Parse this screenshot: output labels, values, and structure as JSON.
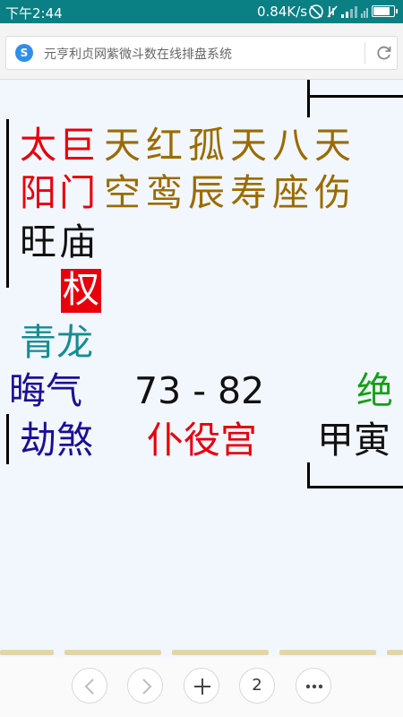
{
  "status_bar": {
    "time": "下午2:44",
    "network_speed": "0.84K/s",
    "battery_level": 0.85
  },
  "browser": {
    "page_title": "元亨利贞网紫微斗数在线排盘系统",
    "site_icon": "S"
  },
  "palace": {
    "main_stars": [
      {
        "top": "太",
        "bottom": "阳",
        "brightness": "旺"
      },
      {
        "top": "巨",
        "bottom": "门",
        "brightness": "庙"
      }
    ],
    "minor_stars": [
      {
        "top": "天",
        "bottom": "空"
      },
      {
        "top": "红",
        "bottom": "鸾"
      },
      {
        "top": "孤",
        "bottom": "辰"
      },
      {
        "top": "天",
        "bottom": "寿"
      },
      {
        "top": "八",
        "bottom": "座"
      },
      {
        "top": "天",
        "bottom": "伤"
      }
    ],
    "transformation": "权",
    "boshi_spirit": "青龙",
    "suiqian_spirit": "晦气",
    "jiangqian_spirit": "劫煞",
    "age_range": "73 - 82",
    "palace_name": "仆役宫",
    "changsheng": "绝",
    "stem_branch": "甲寅"
  },
  "toolbar": {
    "back_icon": "chevron-left-icon",
    "forward_icon": "chevron-right-icon",
    "new_tab_icon": "plus-icon",
    "tab_count": "2",
    "menu_icon": "more-icon"
  },
  "colors": {
    "status_bar": "#0a7f84",
    "red": "#e8000b",
    "gold": "#9b6b00",
    "teal": "#138e93",
    "navy": "#1c0e96",
    "green": "#13a015"
  }
}
